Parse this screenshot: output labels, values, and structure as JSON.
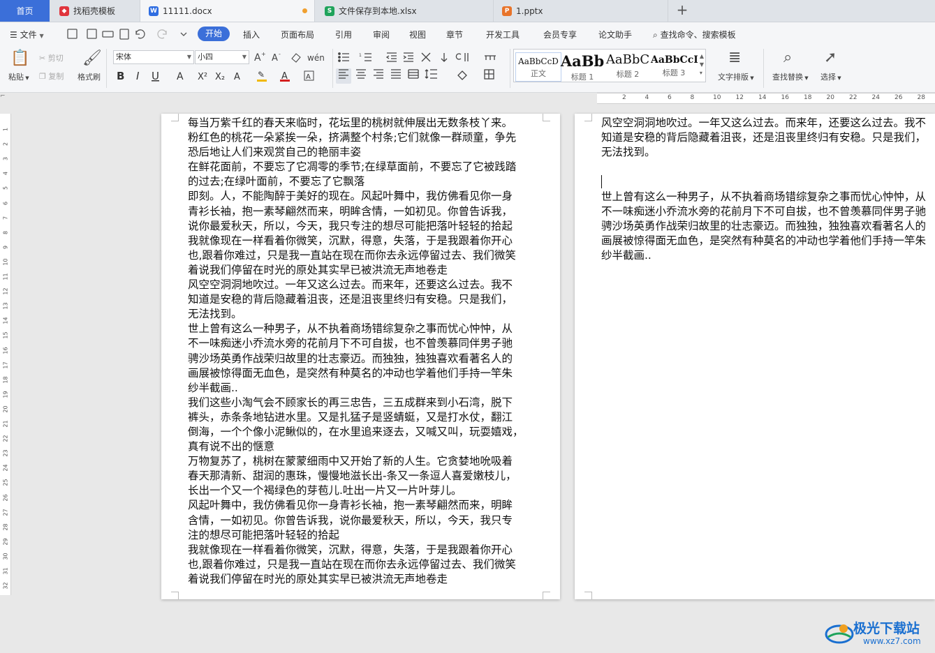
{
  "tabs": {
    "home": "首页",
    "daoke": "找稻壳模板",
    "docx": "11111.docx",
    "xlsx": "文件保存到本地.xlsx",
    "pptx": "1.pptx",
    "add": "+"
  },
  "menu": {
    "file": "文件",
    "items": [
      "开始",
      "插入",
      "页面布局",
      "引用",
      "审阅",
      "视图",
      "章节",
      "开发工具",
      "会员专享",
      "论文助手"
    ],
    "search": "查找命令、搜索模板"
  },
  "ribbon": {
    "paste": "粘贴",
    "cut": "剪切",
    "copy": "复制",
    "format_painter": "格式刷",
    "font_name": "宋体",
    "font_size": "小四",
    "styles": [
      {
        "preview": "AaBbCcD",
        "name": "正文"
      },
      {
        "preview": "AaBb",
        "name": "标题 1"
      },
      {
        "preview": "AaBbC",
        "name": "标题 2"
      },
      {
        "preview": "AaBbCcI",
        "name": "标题 3"
      }
    ],
    "text_layout": "文字排版",
    "find_replace": "查找替换",
    "select": "选择"
  },
  "ruler": {
    "h_marks": [
      "2",
      "4",
      "6",
      "8",
      "10",
      "12",
      "14",
      "16",
      "18",
      "20",
      "22",
      "24",
      "26",
      "28"
    ],
    "v_marks": [
      "1",
      "2",
      "3",
      "4",
      "5",
      "6",
      "7",
      "8",
      "9",
      "10",
      "11",
      "12",
      "13",
      "14",
      "15",
      "16",
      "17",
      "18",
      "19",
      "20",
      "21",
      "22",
      "23",
      "24",
      "25",
      "26",
      "27",
      "28",
      "29",
      "30",
      "31",
      "32"
    ]
  },
  "page1_lines": [
    "每当万紫千红的春天来临时，花坛里的桃树就伸展出无数条枝丫来。",
    "粉红色的桃花一朵紧挨一朵，挤满整个村条;它们就像一群顽童，争先",
    "恐后地让人们来观赏自己的艳丽丰姿",
    "在鲜花面前，不要忘了它凋零的季节;在绿草面前，不要忘了它被践踏",
    "的过去;在绿叶面前，不要忘了它飘落",
    "即刻。人，不能陶醉于美好的现在。风起叶舞中，我仿佛看见你一身",
    "青衫长袖，抱一素琴翩然而来，明眸含情，一如初见。你曾告诉我，",
    "说你最爱秋天，所以，今天，我只专注的想尽可能把落叶轻轻的拾起",
    "我就像现在一样看着你微笑，沉默，得意，失落，于是我跟着你开心",
    "也,跟着你难过，只是我一直站在现在而你去永远停留过去、我们微笑",
    "着说我们停留在时光的原处其实早已被洪流无声地卷走",
    "风空空洞洞地吹过。一年又这么过去。而来年，还要这么过去。我不",
    "知道是安稳的背后隐藏着沮丧，还是沮丧里终归有安稳。只是我们，",
    "无法找到。",
    "世上曾有这么一种男子，从不执着商场错综复杂之事而忧心忡忡，从",
    "不一味痴迷小乔流水旁的花前月下不可自拔，也不曾羡慕同伴男子驰",
    "骋沙场英勇作战荣归故里的壮志豪迈。而独独，独独喜欢看著名人的",
    "画展被惊得面无血色，是突然有种莫名的冲动也学着他们手持一竿朱",
    "纱半截画..",
    "我们这些小淘气会不顾家长的再三忠告，三五成群来到小石湾，脱下",
    "裤头，赤条条地钻进水里。又是扎猛子是竖蜻蜓，又是打水仗，翻江",
    "倒海，一个个像小泥鳅似的，在水里追来逐去，又喊又叫，玩耍嬉戏，",
    "真有说不出的惬意",
    "万物复苏了，桃树在蒙蒙细雨中又开始了新的人生。它贪婪地吮吸着",
    "春天那清新、甜润的惠珠，慢慢地滋长出-条又一条逗人喜爱嫩枝儿，",
    "长出一个又一个褐绿色的芽苞儿.吐出一片又一片叶芽儿。",
    "风起叶舞中，我仿佛看见你一身青衫长袖，抱一素琴翩然而来，明眸",
    "含情，一如初见。你曾告诉我，说你最爱秋天，所以，今天，我只专",
    "注的想尽可能把落叶轻轻的拾起",
    "我就像现在一样看着你微笑，沉默，得意，失落，于是我跟着你开心",
    "也,跟着你难过，只是我一直站在现在而你去永远停留过去、我们微笑",
    "着说我们停留在时光的原处其实早已被洪流无声地卷走"
  ],
  "page2_lines_a": [
    "风空空洞洞地吹过。一年又这么过去。而来年，还要这么过去。我不",
    "知道是安稳的背后隐藏着沮丧，还是沮丧里终归有安稳。只是我们，",
    "无法找到。"
  ],
  "page2_lines_b": [
    "世上曾有这么一种男子，从不执着商场错综复杂之事而忧心忡忡，从",
    "不一味痴迷小乔流水旁的花前月下不可自拔，也不曾羡慕同伴男子驰",
    "骋沙场英勇作战荣归故里的壮志豪迈。而独独，独独喜欢看著名人的",
    "画展被惊得面无血色，是突然有种莫名的冲动也学着他们手持一竿朱",
    "纱半截画.."
  ],
  "watermark": {
    "title": "极光下载站",
    "url": "www.xz7.com"
  }
}
